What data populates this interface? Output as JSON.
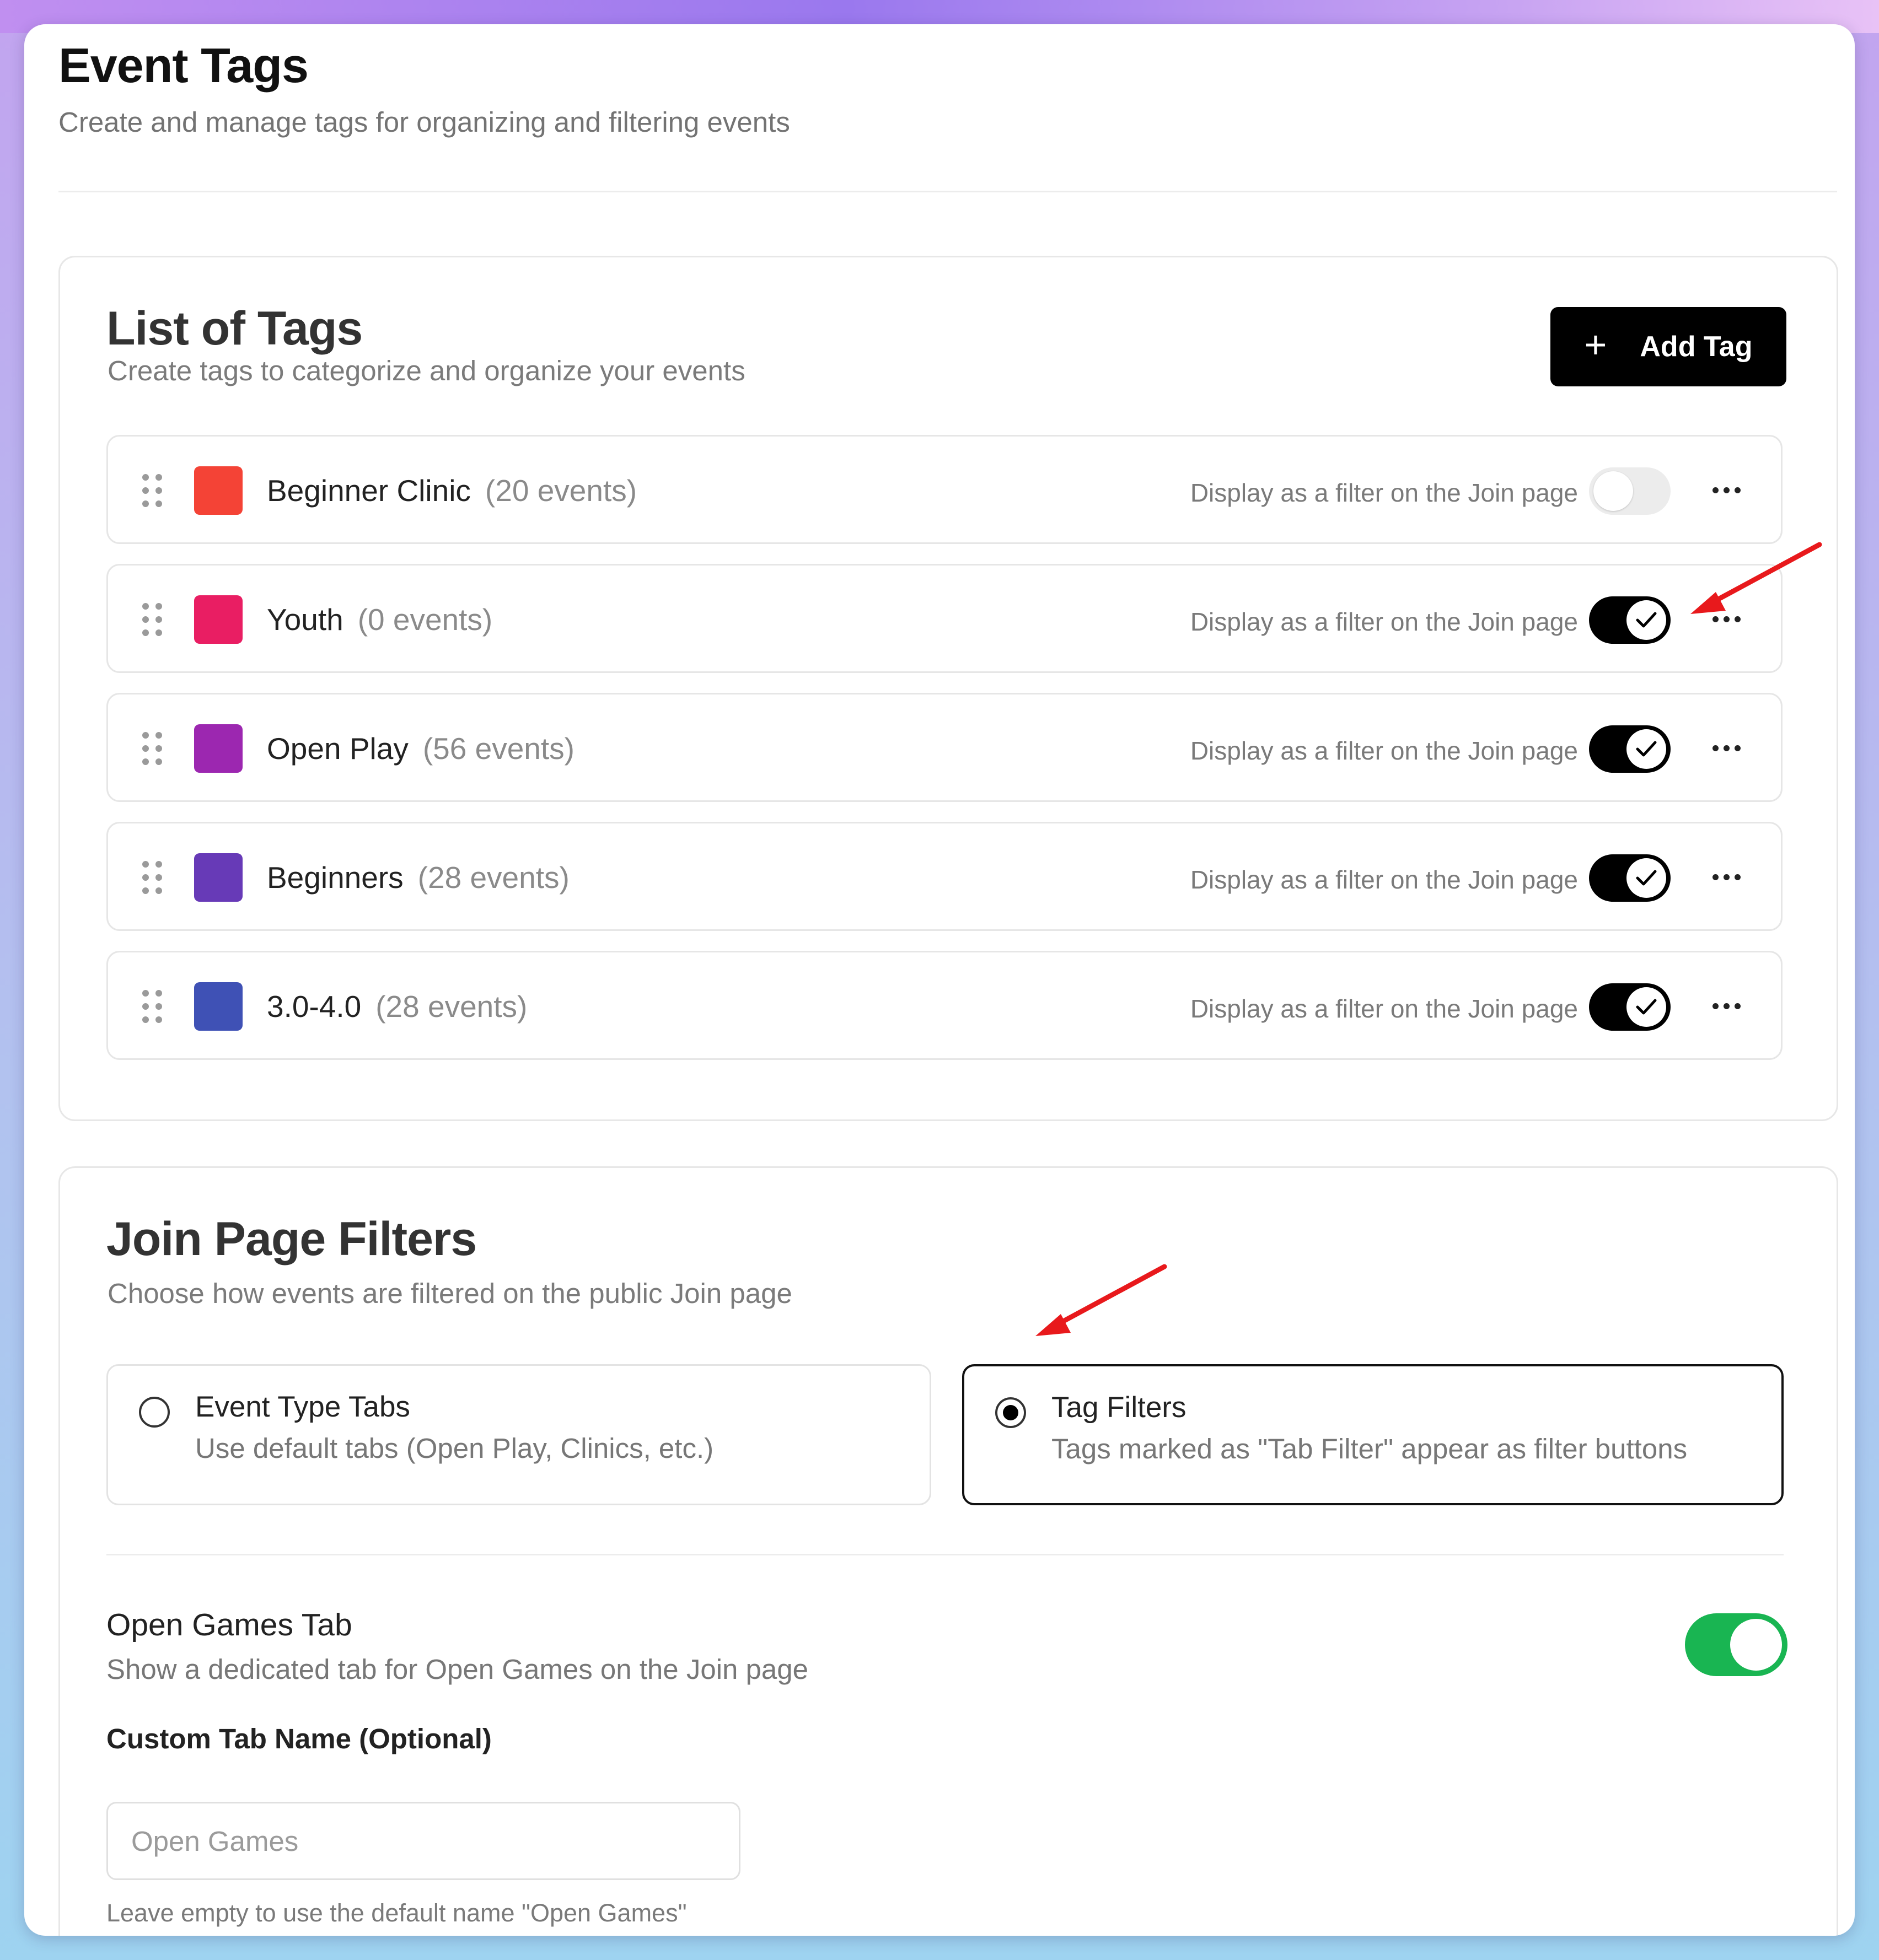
{
  "header": {
    "title": "Event Tags",
    "subtitle": "Create and manage tags for organizing and filtering events"
  },
  "tags_section": {
    "title": "List of Tags",
    "subtitle": "Create tags to categorize and organize your events",
    "add_button_label": "Add Tag",
    "add_button_icon": "+",
    "filter_label": "Display as a filter on the Join page",
    "tags": [
      {
        "name": "Beginner Clinic",
        "count": "(20 events)",
        "color": "#f44336",
        "filter_enabled": false
      },
      {
        "name": "Youth",
        "count": "(0 events)",
        "color": "#e91e63",
        "filter_enabled": true
      },
      {
        "name": "Open Play",
        "count": "(56 events)",
        "color": "#9c27b0",
        "filter_enabled": true
      },
      {
        "name": "Beginners",
        "count": "(28 events)",
        "color": "#673ab7",
        "filter_enabled": true
      },
      {
        "name": "3.0-4.0",
        "count": "(28 events)",
        "color": "#3f51b5",
        "filter_enabled": true
      }
    ]
  },
  "join_section": {
    "title": "Join Page Filters",
    "subtitle": "Choose how events are filtered on the public Join page",
    "options": [
      {
        "title": "Event Type Tabs",
        "description": "Use default tabs (Open Play, Clinics, etc.)",
        "selected": false
      },
      {
        "title": "Tag Filters",
        "description": "Tags marked as \"Tab Filter\" appear as filter buttons",
        "selected": true
      }
    ],
    "open_games": {
      "title": "Open Games Tab",
      "subtitle": "Show a dedicated tab for Open Games on the Join page",
      "enabled": true,
      "toggle_color": "#19b552"
    },
    "custom_tab": {
      "label": "Custom Tab Name (Optional)",
      "placeholder": "Open Games",
      "value": "",
      "help": "Leave empty to use the default name \"Open Games\""
    }
  },
  "annotations": {
    "arrow_color": "#e8191c"
  }
}
